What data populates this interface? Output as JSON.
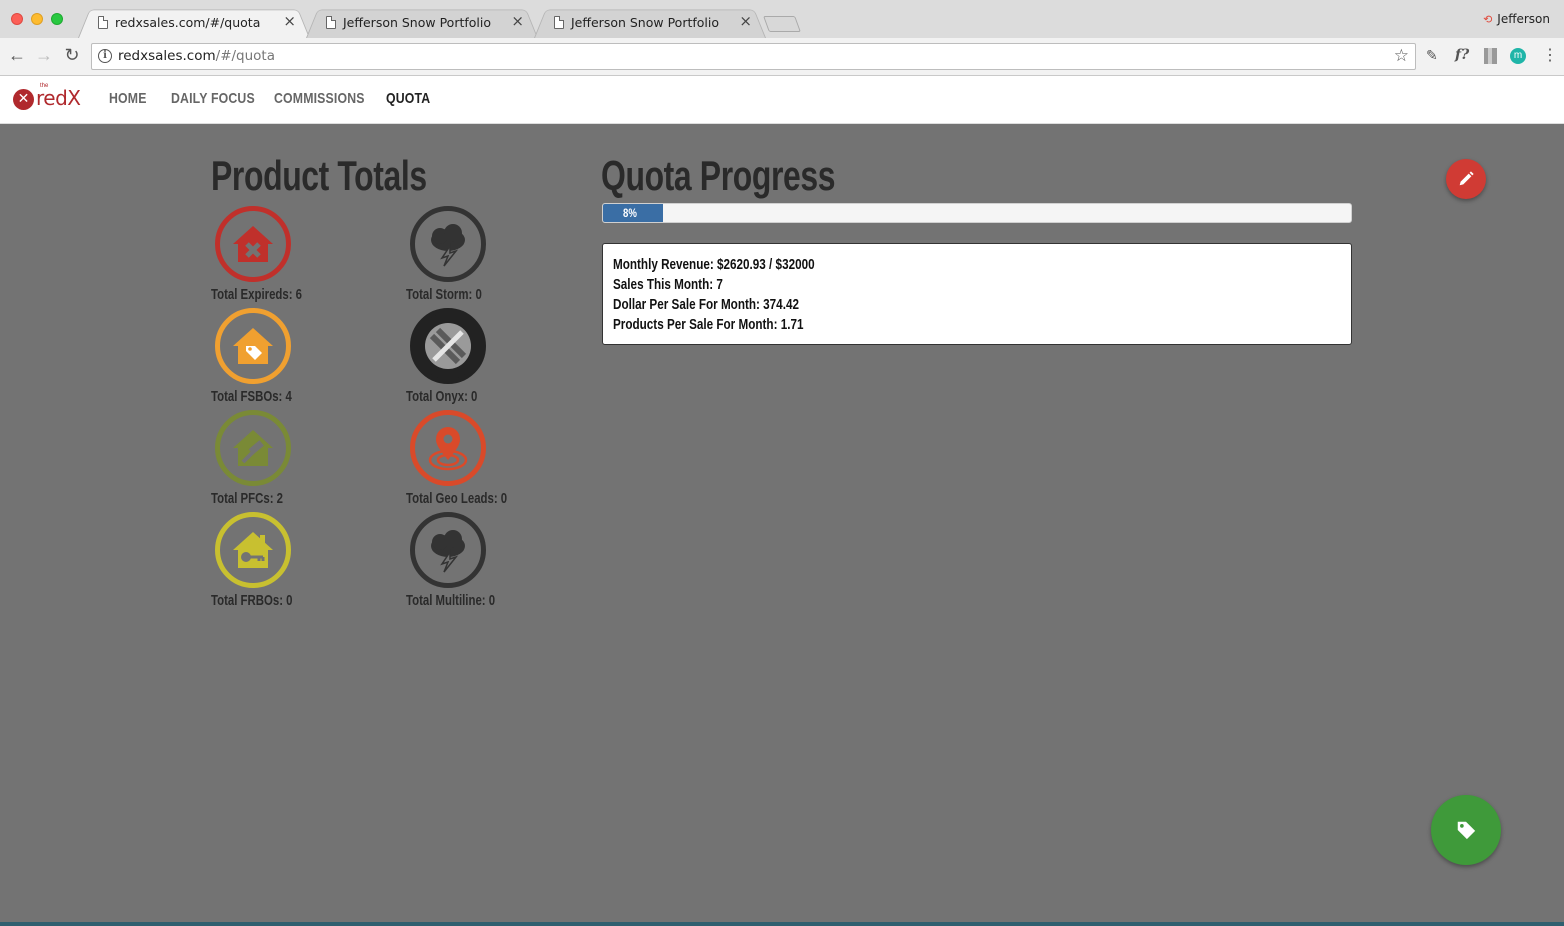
{
  "browser": {
    "tabs": [
      {
        "title": "redxsales.com/#/quota",
        "active": true
      },
      {
        "title": "Jefferson Snow Portfolio",
        "active": false
      },
      {
        "title": "Jefferson Snow Portfolio",
        "active": false
      }
    ],
    "close_glyph": "×",
    "profile_name": "Jefferson",
    "url_host": "redxsales.com",
    "url_path": "/#/quota"
  },
  "app": {
    "brand": "redX",
    "brand_prefix": "the",
    "nav": [
      {
        "label": "HOME",
        "active": false
      },
      {
        "label": "DAILY FOCUS",
        "active": false
      },
      {
        "label": "COMMISSIONS",
        "active": false
      },
      {
        "label": "QUOTA",
        "active": true
      }
    ]
  },
  "product_totals": {
    "title": "Product Totals",
    "items": [
      {
        "label": "Total Expireds: 6",
        "icon": "expired-house-icon",
        "color": "#c0302b"
      },
      {
        "label": "Total Storm: 0",
        "icon": "storm-cloud-icon",
        "color": "#333333"
      },
      {
        "label": "Total FSBOs: 4",
        "icon": "fsbo-house-tag-icon",
        "color": "#f0a030"
      },
      {
        "label": "Total Onyx: 0",
        "icon": "onyx-icon",
        "color": "#222222"
      },
      {
        "label": "Total PFCs: 2",
        "icon": "pfc-house-gavel-icon",
        "color": "#7a8a36"
      },
      {
        "label": "Total Geo Leads: 0",
        "icon": "geo-pin-icon",
        "color": "#d94a2a"
      },
      {
        "label": "Total FRBOs: 0",
        "icon": "frbo-house-key-icon",
        "color": "#c8c030"
      },
      {
        "label": "Total Multiline: 0",
        "icon": "multiline-cloud-icon",
        "color": "#333333"
      }
    ]
  },
  "quota": {
    "title": "Quota Progress",
    "percent": 8,
    "percent_label": "8%",
    "bar_color": "#3a6ea5",
    "stats": [
      "Monthly Revenue: $2620.93 / $32000",
      "Sales This Month: 7",
      "Dollar Per Sale For Month: 374.42",
      "Products Per Sale For Month: 1.71"
    ]
  },
  "actions": {
    "edit_button_icon": "pencil-icon",
    "edit_color": "#d03b34",
    "tag_button_icon": "tag-icon",
    "tag_color": "#3f9a3a"
  }
}
